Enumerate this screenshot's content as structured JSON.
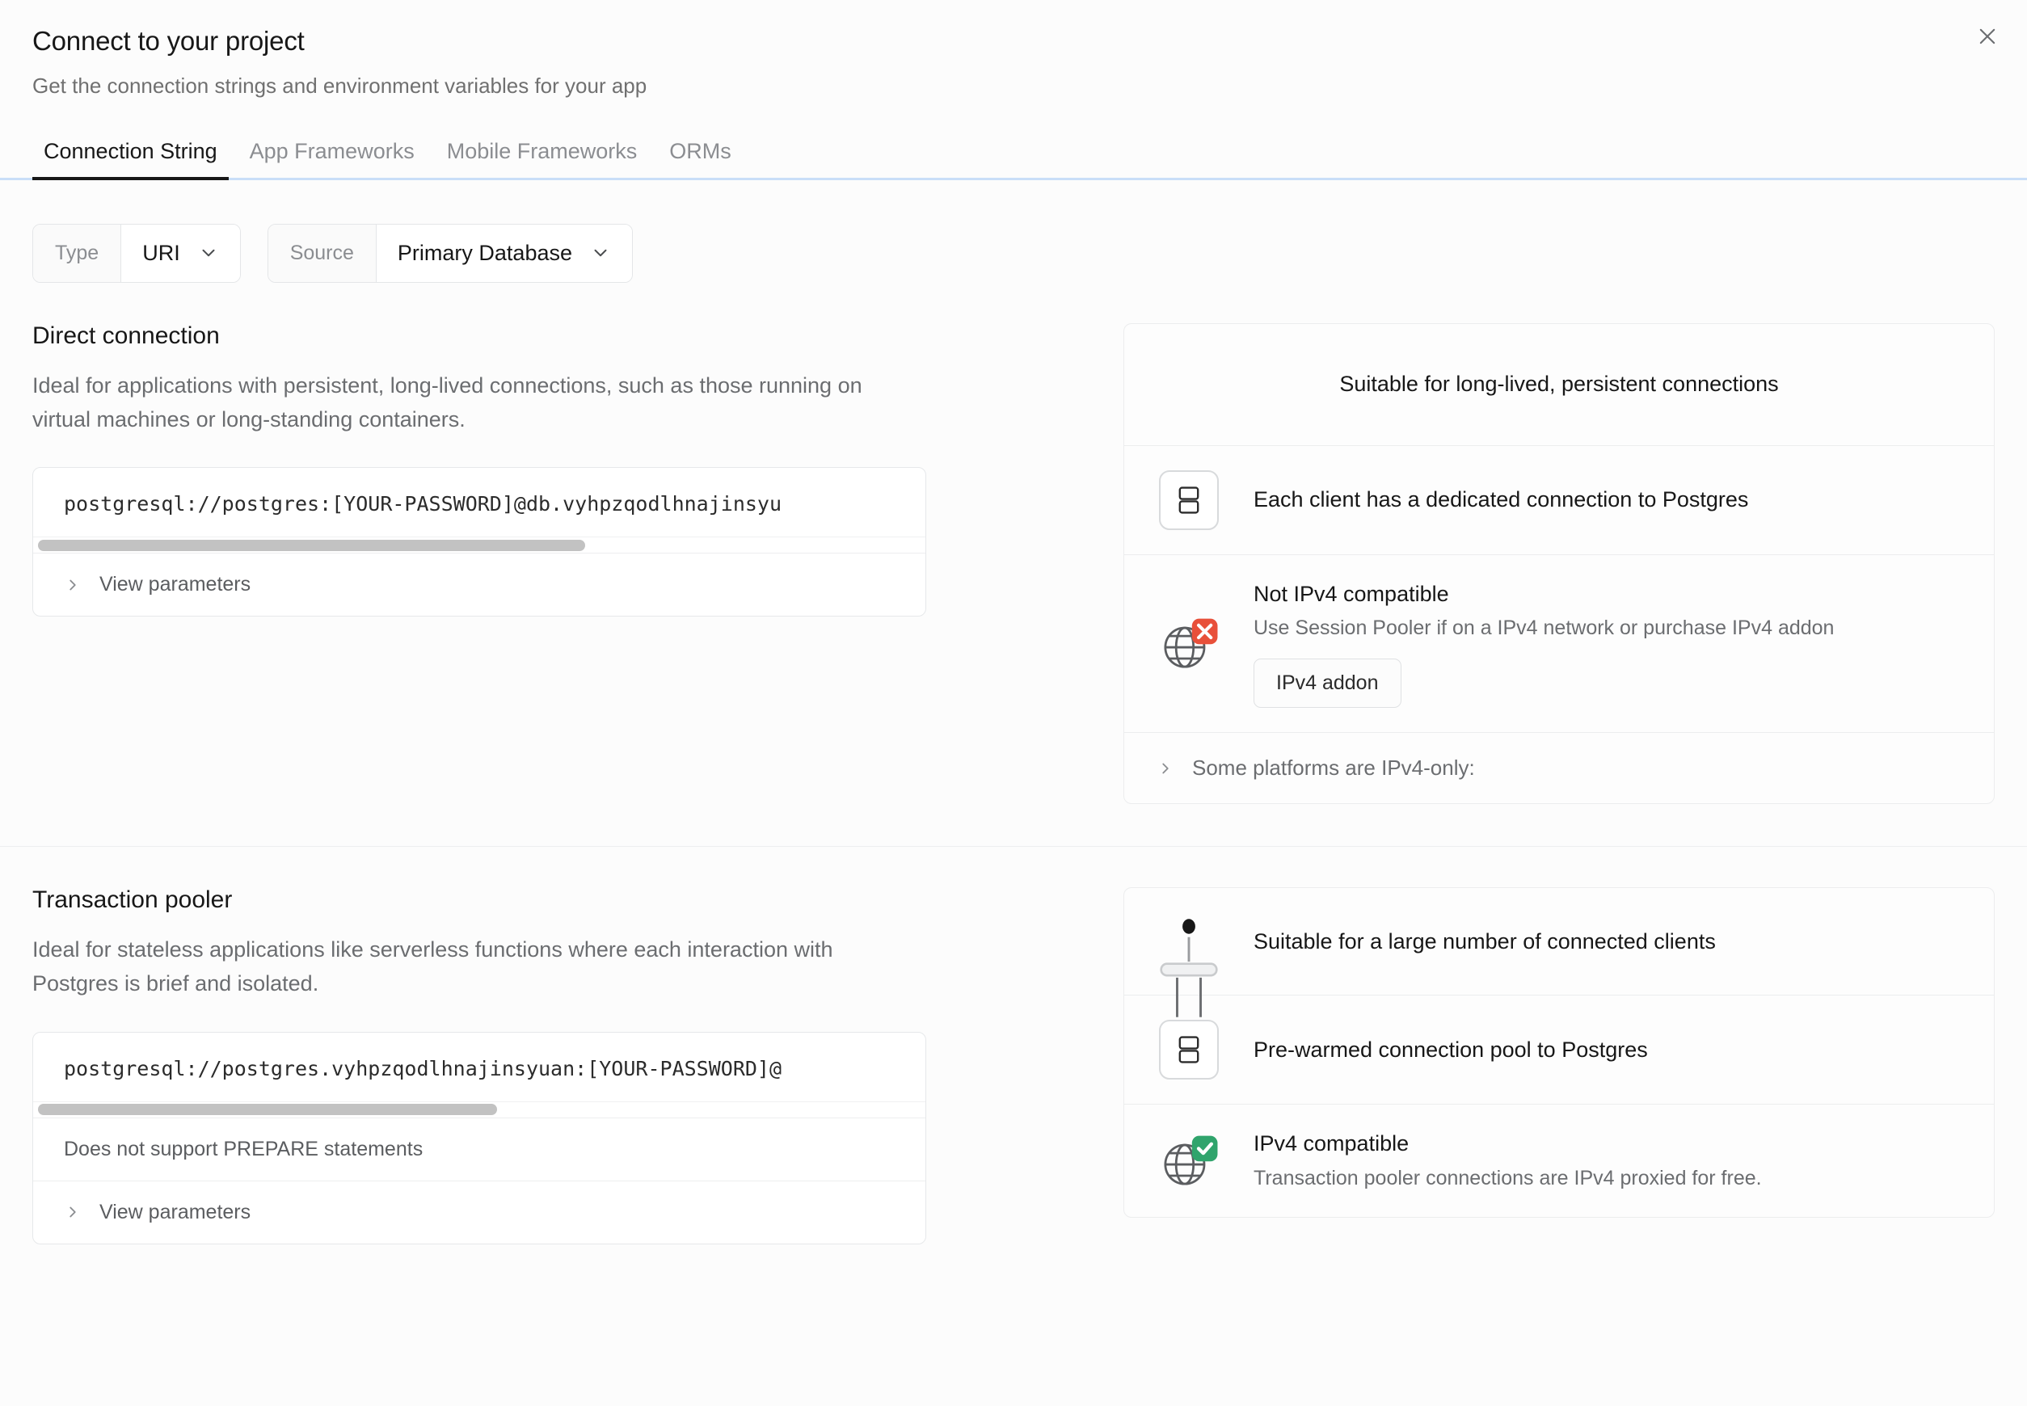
{
  "header": {
    "title": "Connect to your project",
    "subtitle": "Get the connection strings and environment variables for your app",
    "close_icon": "close-icon"
  },
  "tabs": [
    {
      "label": "Connection String",
      "active": true
    },
    {
      "label": "App Frameworks",
      "active": false
    },
    {
      "label": "Mobile Frameworks",
      "active": false
    },
    {
      "label": "ORMs",
      "active": false
    }
  ],
  "selectors": {
    "type": {
      "label": "Type",
      "value": "URI"
    },
    "source": {
      "label": "Source",
      "value": "Primary Database"
    }
  },
  "sections": [
    {
      "title": "Direct connection",
      "description": "Ideal for applications with persistent, long-lived connections, such as those running on virtual machines or long-standing containers.",
      "connection_string": "postgresql://postgres:[YOUR-PASSWORD]@db.vyhpzqodlhnajinsyu",
      "note": null,
      "view_parameters": "View parameters",
      "info": {
        "headline": "Suitable for long-lived, persistent connections",
        "dedicated": "Each client has a dedicated connection to Postgres",
        "ipv4_title": "Not IPv4 compatible",
        "ipv4_sub": "Use Session Pooler if on a IPv4 network or purchase IPv4 addon",
        "ipv4_button": "IPv4 addon",
        "expand": "Some platforms are IPv4-only:"
      }
    },
    {
      "title": "Transaction pooler",
      "description": "Ideal for stateless applications like serverless functions where each interaction with Postgres is brief and isolated.",
      "connection_string": "postgresql://postgres.vyhpzqodlhnajinsyuan:[YOUR-PASSWORD]@",
      "note": "Does not support PREPARE statements",
      "view_parameters": "View parameters",
      "info": {
        "headline": "Suitable for a large number of connected clients",
        "prewarmed": "Pre-warmed connection pool to Postgres",
        "ipv4_title": "IPv4 compatible",
        "ipv4_sub": "Transaction pooler connections are IPv4 proxied for free."
      }
    }
  ],
  "colors": {
    "error_badge": "#E8503A",
    "success_badge": "#30A46C",
    "tab_underline": "#C9DEF8",
    "active_tab": "#171717"
  }
}
